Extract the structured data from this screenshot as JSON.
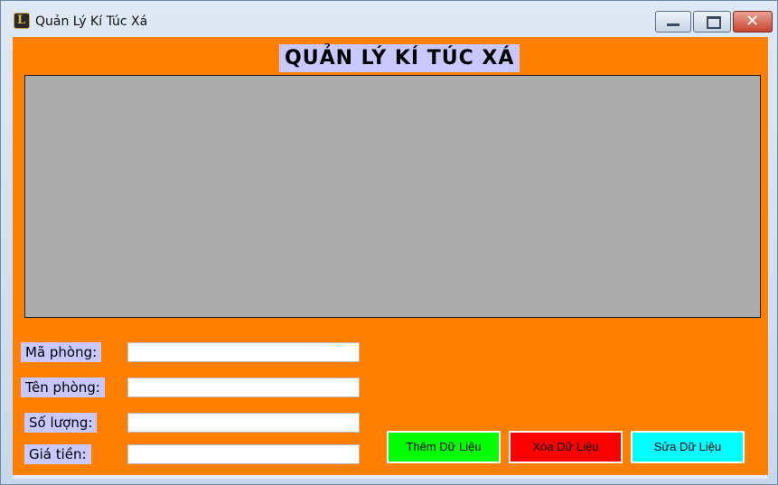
{
  "window": {
    "title": "Quản Lý Kí Túc Xá",
    "controls": {
      "minimize": "minimize",
      "maximize": "maximize",
      "close": "close"
    }
  },
  "form": {
    "heading": "QUẢN LÝ KÍ TÚC XÁ",
    "fields": [
      {
        "label": "Mã phòng:",
        "value": ""
      },
      {
        "label": "Tên phòng:",
        "value": ""
      },
      {
        "label": "Số lượng:",
        "value": ""
      },
      {
        "label": "Giá tiền:",
        "value": ""
      }
    ],
    "buttons": {
      "add": "Thêm Dữ Liệu",
      "delete": "Xóa Dữ Liệu",
      "edit": "Sửa Dữ Liệu"
    }
  },
  "colors": {
    "background": "#ff7f00",
    "label_bg": "#c8c8ff",
    "grid_bg": "#ababab",
    "add_button": "#00ff00",
    "delete_button": "#ff0000",
    "edit_button": "#00ffff"
  },
  "icons": {
    "app": "league-logo-icon",
    "minimize": "minimize-icon",
    "maximize": "maximize-icon",
    "close": "close-icon"
  }
}
